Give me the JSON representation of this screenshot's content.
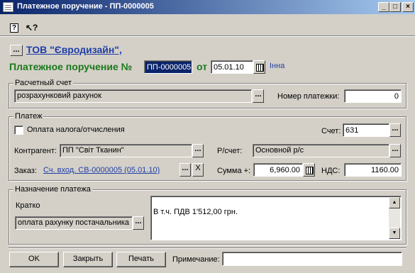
{
  "window": {
    "title": "Платежное поручение - ПП-0000005",
    "minimize": "_",
    "maximize": "□",
    "close": "×"
  },
  "toolbar": {
    "help_icon": "?",
    "whatsthis_icon": "↖?"
  },
  "header": {
    "ellipsis": "...",
    "company": "ТОВ \"Євродизайн\",",
    "doc_title": "Платежное поручение №",
    "doc_number": "ПП-0000005",
    "date_prefix": "от",
    "date": "05.01.10",
    "user": "Інна"
  },
  "account_group": {
    "label": "Расчетный счет",
    "account_value": "розрахунковий рахунок",
    "ellipsis": "...",
    "payment_number_label": "Номер платежки:",
    "payment_number": "0"
  },
  "payment_group": {
    "label": "Платеж",
    "tax_checkbox_label": "Оплата налога/отчисления",
    "account_label": "Счет:",
    "account_value": "631",
    "counterparty_label": "Контрагент:",
    "counterparty_value": "ПП \"Світ Тканин\"",
    "rs_label": "Р/счет:",
    "rs_value": "Основной р/с",
    "order_label": "Заказ:",
    "order_value": "Сч. вход. СВ-0000005 (05.01.10)",
    "clear": "X",
    "sum_label": "Сумма +:",
    "sum_value": "6,960.00",
    "vat_label": "НДС:",
    "vat_value": "1160.00",
    "ellipsis": "..."
  },
  "purpose_group": {
    "label": "Назначение платежа",
    "short_label": "Кратко",
    "short_value": "оплата рахунку постачальника",
    "text": "В т.ч. ПДВ     1'512,00 грн.",
    "ellipsis": "...",
    "scroll_up": "▲",
    "scroll_down": "▼"
  },
  "footer": {
    "ok": "OK",
    "close": "Закрыть",
    "print": "Печать",
    "note_label": "Примечание:",
    "note_value": ""
  }
}
